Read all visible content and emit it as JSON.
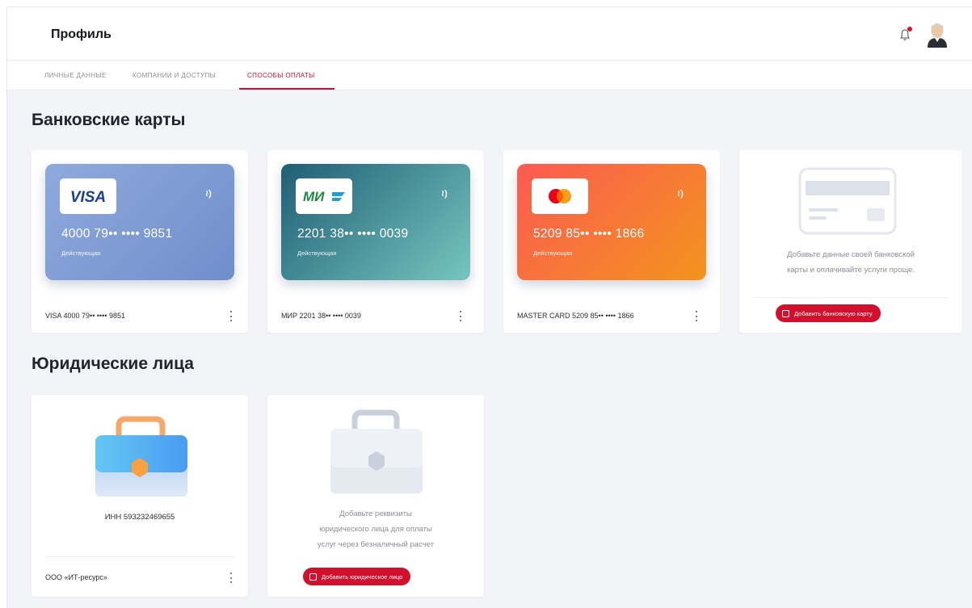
{
  "header": {
    "title": "Профиль"
  },
  "tabs": [
    {
      "label": "ЛИЧНЫЕ ДАННЫЕ",
      "active": false
    },
    {
      "label": "КОМПАНИИ И ДОСТУПЫ",
      "active": false
    },
    {
      "label": "СПОСОБЫ ОПЛАТЫ",
      "active": true
    }
  ],
  "bank": {
    "title": "Банковские карты",
    "cards": [
      {
        "logo": "VISA",
        "number": "4000 79•• •••• 9851",
        "status": "Действующая",
        "caption": "VISA 4000 79•• •••• 9851",
        "gradient": [
          "#8fa9dc",
          "#6f8fcb"
        ]
      },
      {
        "logo": "МИР",
        "number": "2201 38•• •••• 0039",
        "status": "Действующая",
        "caption": "МИР 2201 38•• •••• 0039",
        "gradient": [
          "#1f5e75",
          "#76c6bf"
        ]
      },
      {
        "logo": "mastercard",
        "number": "5209 85•• •••• 1866",
        "status": "Действующая",
        "caption": "MASTER CARD 5209 85•• •••• 1866",
        "gradient": [
          "#fb5a52",
          "#f3941d"
        ]
      }
    ],
    "add": {
      "hint_line1": "Добавьте данные своей банковской",
      "hint_line2": "карты и оплачивайте услуги проще.",
      "button": "Добавить банковскую карту"
    }
  },
  "legal": {
    "title": "Юридические лица",
    "entity": {
      "inn": "ИНН 593232469655",
      "name": "ООО «ИТ-ресурс»"
    },
    "add": {
      "hint_line1": "Добавьте реквизиты",
      "hint_line2": "юридического лица для оплаты",
      "hint_line3": "услуг через безналичный расчет",
      "button": "Добавить юридическое лицо"
    }
  },
  "colors": {
    "accent": "#d2102e",
    "background": "#f3f4f8"
  },
  "icons": [
    "bell-icon",
    "avatar",
    "nfc-icon",
    "more-vertical-icon",
    "briefcase-icon",
    "add-card-icon",
    "add-company-icon"
  ]
}
